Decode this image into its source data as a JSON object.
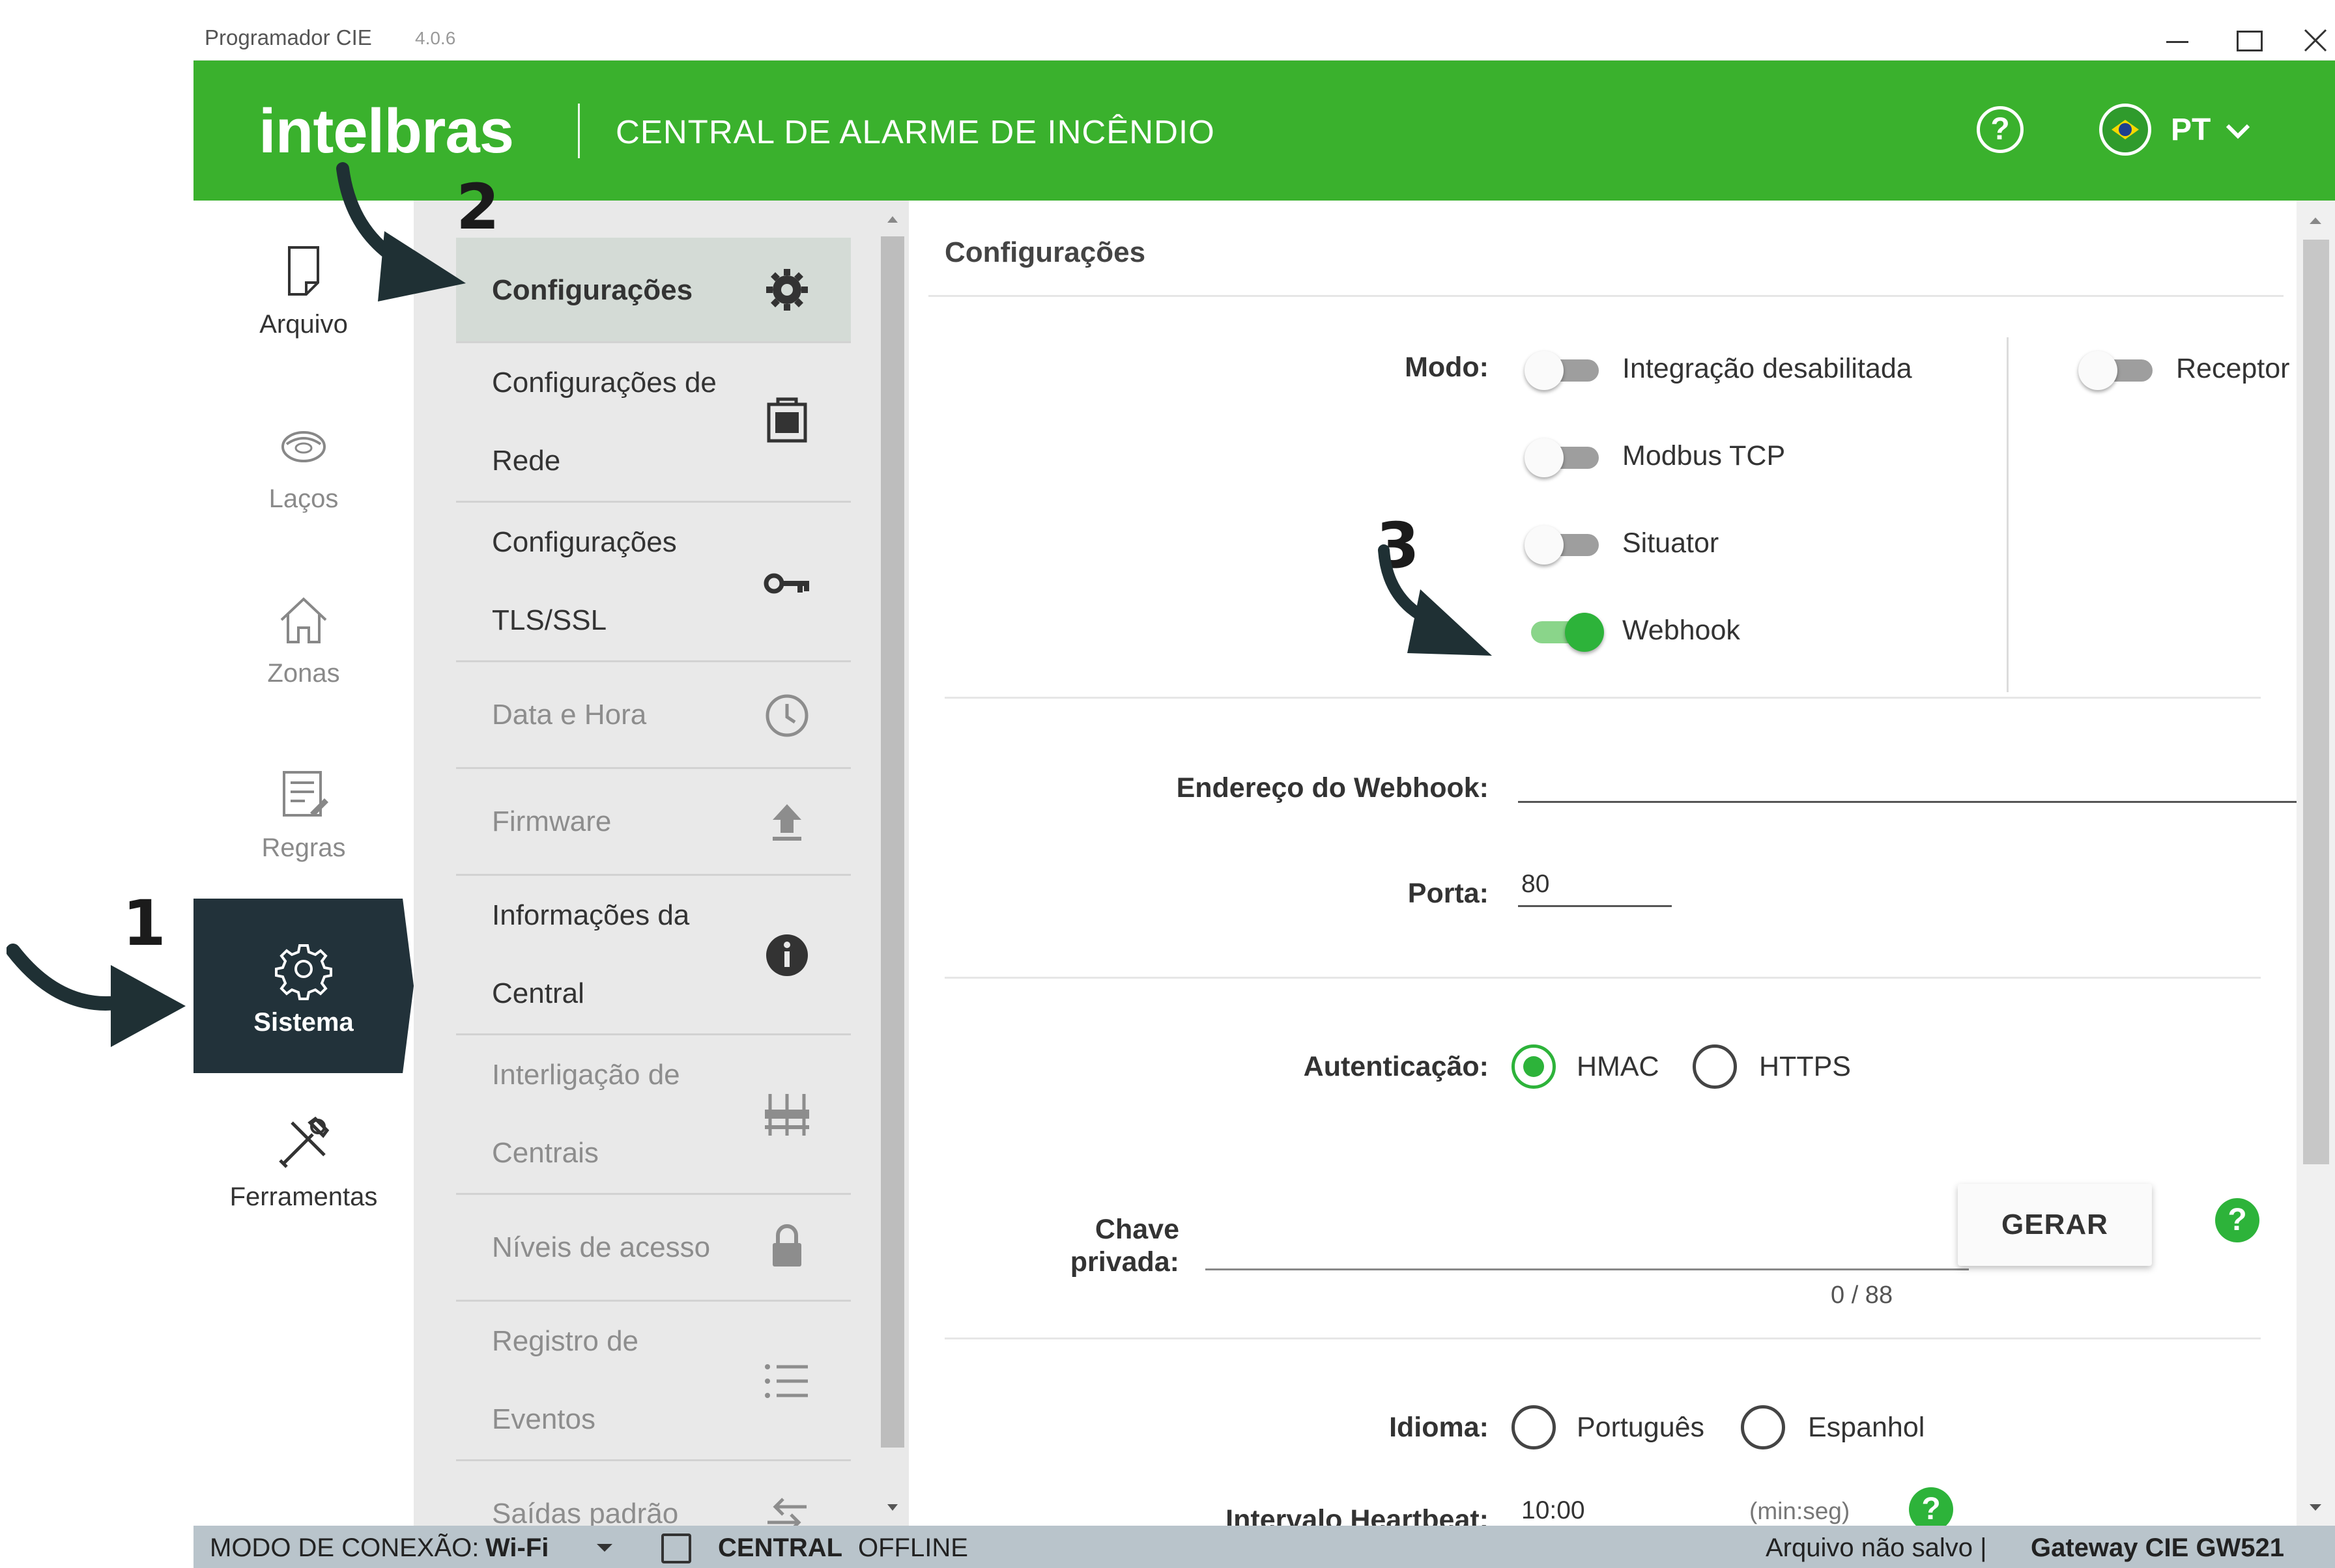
{
  "window": {
    "title": "Programador CIE",
    "version": "4.0.6"
  },
  "header": {
    "logo": "intelbras",
    "title": "CENTRAL DE ALARME DE INCÊNDIO",
    "help_icon": "help-circle-icon",
    "language": "PT"
  },
  "main_nav": [
    {
      "label": "Arquivo",
      "icon": "file-icon"
    },
    {
      "label": "Laços",
      "icon": "smoke-detector-icon"
    },
    {
      "label": "Zonas",
      "icon": "home-icon"
    },
    {
      "label": "Regras",
      "icon": "rules-icon"
    },
    {
      "label": "Sistema",
      "icon": "gear-icon",
      "active": true
    },
    {
      "label": "Ferramentas",
      "icon": "tools-icon"
    }
  ],
  "submenu": [
    {
      "line1": "Configurações",
      "line2": "",
      "icon": "gear-icon",
      "active": true
    },
    {
      "line1": "Configurações de",
      "line2": "Rede",
      "icon": "network-icon"
    },
    {
      "line1": "Configurações",
      "line2": "TLS/SSL",
      "icon": "key-icon"
    },
    {
      "line1": "Data e Hora",
      "line2": "",
      "icon": "clock-icon",
      "disabled": true
    },
    {
      "line1": "Firmware",
      "line2": "",
      "icon": "upload-icon",
      "disabled": true
    },
    {
      "line1": "Informações da",
      "line2": "Central",
      "icon": "info-icon"
    },
    {
      "line1": "Interligação de",
      "line2": "Centrais",
      "icon": "network-tree-icon",
      "disabled": true
    },
    {
      "line1": "Níveis de acesso",
      "line2": "",
      "icon": "lock-icon",
      "disabled": true
    },
    {
      "line1": "Registro de",
      "line2": "Eventos",
      "icon": "list-icon",
      "disabled": true
    },
    {
      "line1": "Saídas padrão",
      "line2": "",
      "icon": "swap-icon",
      "disabled": true
    }
  ],
  "content": {
    "title": "Configurações",
    "modo_label": "Modo:",
    "modes": [
      {
        "label": "Integração desabilitada",
        "on": false
      },
      {
        "label": "Modbus TCP",
        "on": false
      },
      {
        "label": "Situator",
        "on": false
      },
      {
        "label": "Webhook",
        "on": true
      }
    ],
    "receptor": {
      "label": "Receptor",
      "on": false
    },
    "webhook_label": "Endereço do Webhook:",
    "webhook_value": "",
    "porta_label": "Porta:",
    "porta_value": "80",
    "auth_label": "Autenticação:",
    "auth_options": [
      {
        "label": "HMAC",
        "selected": true
      },
      {
        "label": "HTTPS",
        "selected": false
      }
    ],
    "chave_label_1": "Chave",
    "chave_label_2": "privada:",
    "chave_value": "",
    "chave_counter": "0 / 88",
    "gerar_label": "GERAR",
    "idioma_label": "Idioma:",
    "idioma_options": [
      {
        "label": "Português",
        "selected": false
      },
      {
        "label": "Espanhol",
        "selected": false
      }
    ],
    "heartbeat_label": "Intervalo Heartbeat:",
    "heartbeat_value": "10:00",
    "heartbeat_unit": "(min:seg)"
  },
  "status_bar": {
    "mode_label": "MODO DE CONEXÃO:",
    "mode_value": "Wi-Fi",
    "central_label": "CENTRAL",
    "central_status": "OFFLINE",
    "file_status": "Arquivo não salvo |",
    "gateway": "Gateway CIE GW521"
  },
  "annotations": [
    "1",
    "2",
    "3"
  ],
  "colors": {
    "brand_green": "#3ab12d",
    "active_nav": "#22323a",
    "toggle_on": "#2db33a",
    "statusbar": "#b9c4cb"
  }
}
